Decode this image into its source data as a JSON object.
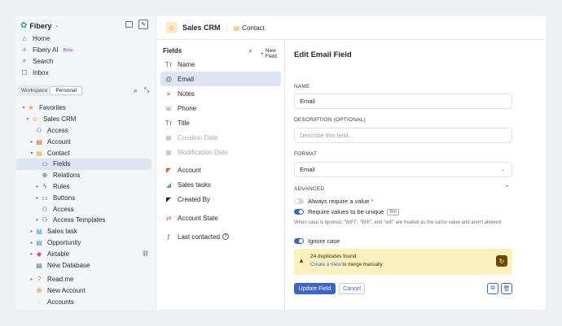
{
  "workspace": {
    "name": "Fibery"
  },
  "nav": {
    "home": "Home",
    "ai": "Fibery AI",
    "ai_badge": "Beta",
    "search": "Search",
    "inbox": "Inbox"
  },
  "scope_tabs": {
    "workspace": "Workspace",
    "personal": "Personal"
  },
  "tree": {
    "favorites": "Favorites",
    "sales_crm": "Sales CRM",
    "access": "Access",
    "account": "Account",
    "contact": "Contact",
    "fields": "Fields",
    "relations": "Relations",
    "rules": "Rules",
    "buttons": "Buttons",
    "access2": "Access",
    "access_templates": "Access Templates",
    "sales_task": "Sales task",
    "opportunity": "Opportunity",
    "airtable": "Airtable",
    "new_database": "New Database",
    "readme": "Read.me",
    "new_account": "New Account",
    "accounts": "Accounts"
  },
  "breadcrumb": {
    "space": "Sales CRM",
    "database": "Contact"
  },
  "fields_panel": {
    "title": "Fields",
    "new_field": "New Field",
    "items": {
      "name": "Name",
      "email": "Email",
      "notes": "Notes",
      "phone": "Phone",
      "title": "Title",
      "creation_date": "Creation Date",
      "modification_date": "Modification Date",
      "account": "Account",
      "sales_tasks": "Sales tasks",
      "created_by": "Created By",
      "account_state": "Account State",
      "last_contacted": "Last contacted"
    }
  },
  "editor": {
    "title": "Edit Email Field",
    "name_label": "NAME",
    "name_value": "Email",
    "desc_label": "DESCRIPTION (OPTIONAL)",
    "desc_placeholder": "Describe this field...",
    "format_label": "FORMAT",
    "format_value": "Email",
    "advanced_label": "ADVANCED",
    "require_value": "Always require a value",
    "require_value_star": "*",
    "require_unique": "Require values to be unique",
    "pro_badge": "Pro",
    "unique_hint": "When case is ignored, \"WiFi\", \"Wifi\", and \"wifi\" are treated as the same value and aren't allowed",
    "ignore_case": "Ignore case",
    "warning_title": "24 duplicates found",
    "warning_link": "Create a View",
    "warning_rest": "to merge manually",
    "update_button": "Update Field",
    "cancel_button": "Cancel"
  },
  "colors": {
    "accent": "#3a67c7",
    "warning_bg": "#fbf1bf",
    "warning_icon": "#6b4a00"
  }
}
